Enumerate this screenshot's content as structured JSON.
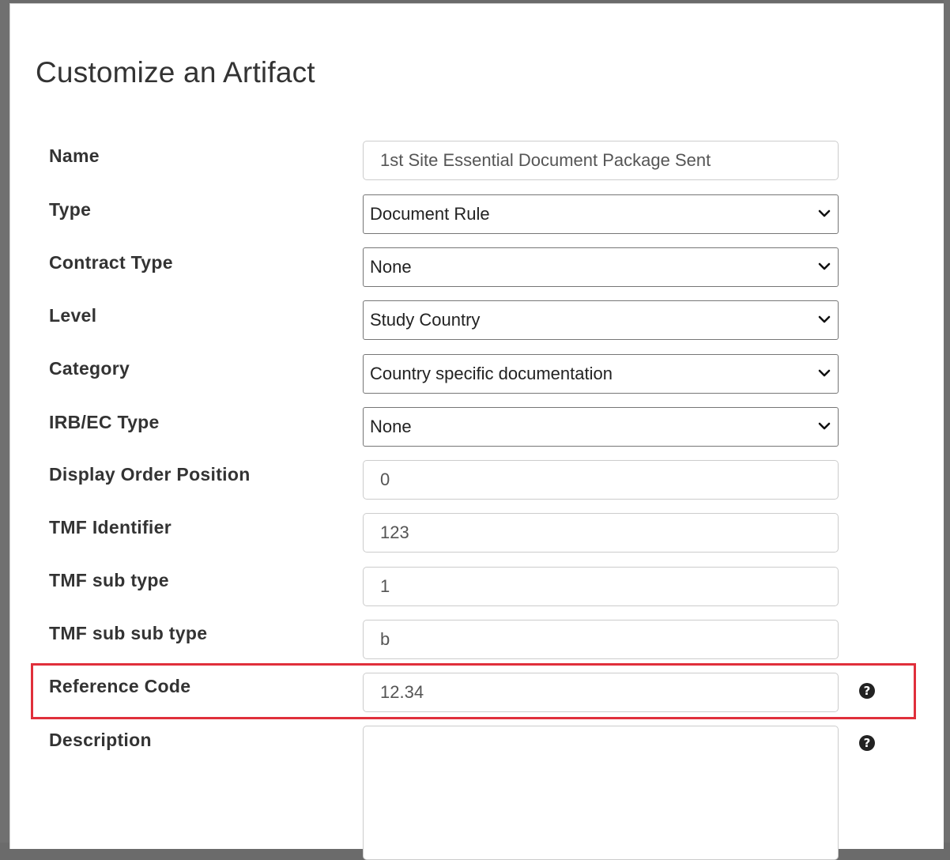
{
  "dialog": {
    "title": "Customize an Artifact"
  },
  "fields": {
    "name": {
      "label": "Name",
      "value": "1st Site Essential Document Package Sent"
    },
    "type": {
      "label": "Type",
      "value": "Document Rule"
    },
    "contract_type": {
      "label": "Contract Type",
      "value": "None"
    },
    "level": {
      "label": "Level",
      "value": "Study Country"
    },
    "category": {
      "label": "Category",
      "value": "Country specific documentation"
    },
    "irb_ec_type": {
      "label": "IRB/EC Type",
      "value": "None"
    },
    "display_order": {
      "label": "Display Order Position",
      "value": "0"
    },
    "tmf_identifier": {
      "label": "TMF Identifier",
      "value": "123"
    },
    "tmf_sub_type": {
      "label": "TMF sub type",
      "value": "1"
    },
    "tmf_sub_sub_type": {
      "label": "TMF sub sub type",
      "value": "b"
    },
    "reference_code": {
      "label": "Reference Code",
      "value": "12.34",
      "help_icon": "question-circle-icon"
    },
    "description": {
      "label": "Description",
      "value": "",
      "help_icon": "question-circle-icon"
    }
  },
  "help_glyph": "?",
  "colors": {
    "highlight": "#e02f3b",
    "backdrop": "#6b6b6b"
  }
}
